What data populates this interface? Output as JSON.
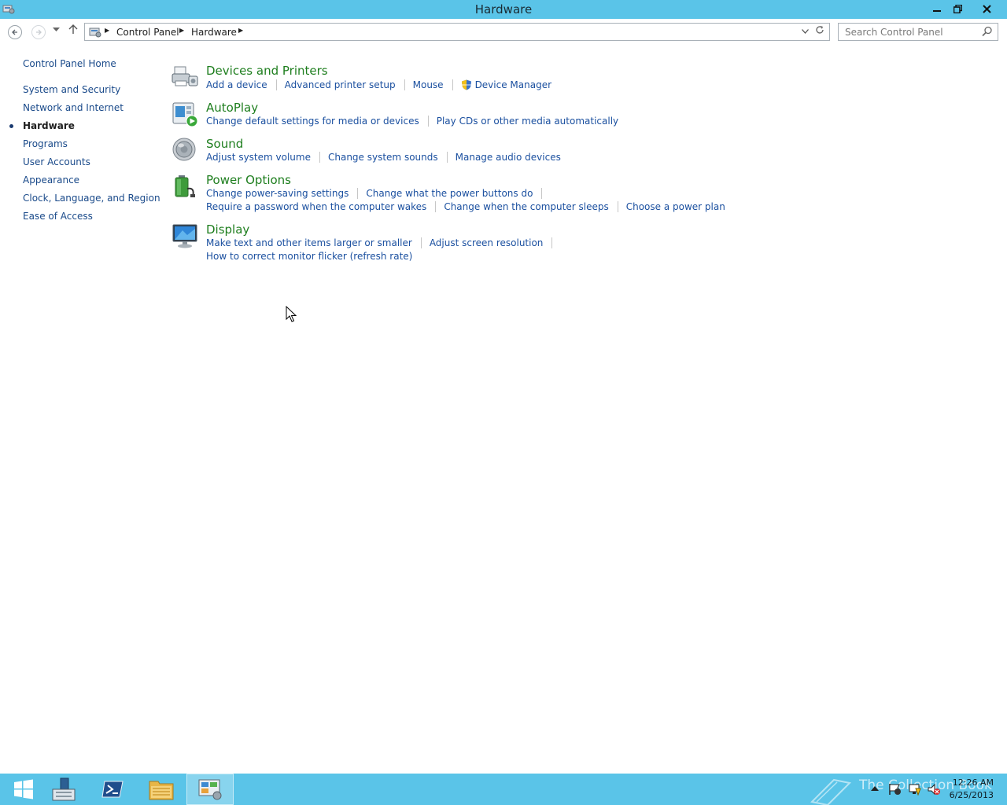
{
  "window": {
    "title": "Hardware",
    "minimize_glyph": "—",
    "restore_glyph": "❐",
    "close_glyph": "✕"
  },
  "address": {
    "crumbs": [
      "Control Panel",
      "Hardware"
    ],
    "search_placeholder": "Search Control Panel"
  },
  "sidebar": {
    "home": "Control Panel Home",
    "items": [
      {
        "label": "System and Security"
      },
      {
        "label": "Network and Internet"
      },
      {
        "label": "Hardware",
        "current": true
      },
      {
        "label": "Programs"
      },
      {
        "label": "User Accounts"
      },
      {
        "label": "Appearance"
      },
      {
        "label": "Clock, Language, and Region"
      },
      {
        "label": "Ease of Access"
      }
    ]
  },
  "categories": [
    {
      "title": "Devices and Printers",
      "icon": "printer-icon",
      "tasks": [
        [
          "Add a device",
          "Advanced printer setup",
          "Mouse",
          "Device Manager"
        ]
      ]
    },
    {
      "title": "AutoPlay",
      "icon": "autoplay-icon",
      "tasks": [
        [
          "Change default settings for media or devices",
          "Play CDs or other media automatically"
        ]
      ]
    },
    {
      "title": "Sound",
      "icon": "speaker-icon",
      "tasks": [
        [
          "Adjust system volume",
          "Change system sounds",
          "Manage audio devices"
        ]
      ]
    },
    {
      "title": "Power Options",
      "icon": "battery-icon",
      "tasks": [
        [
          "Change power-saving settings",
          "Change what the power buttons do"
        ],
        [
          "Require a password when the computer wakes",
          "Change when the computer sleeps",
          "Choose a power plan"
        ]
      ]
    },
    {
      "title": "Display",
      "icon": "monitor-icon",
      "tasks": [
        [
          "Make text and other items larger or smaller",
          "Adjust screen resolution"
        ],
        [
          "How to correct monitor flicker (refresh rate)"
        ]
      ]
    }
  ],
  "taskbar": {
    "time": "12:26 AM",
    "date": "6/25/2013",
    "watermark": "The Collection Book",
    "buttons": [
      "start-button",
      "server-manager",
      "powershell",
      "file-explorer",
      "control-panel"
    ]
  },
  "colors": {
    "chrome": "#5ac4e8",
    "link": "#1a4f9f",
    "category_title": "#1e7e1e"
  }
}
